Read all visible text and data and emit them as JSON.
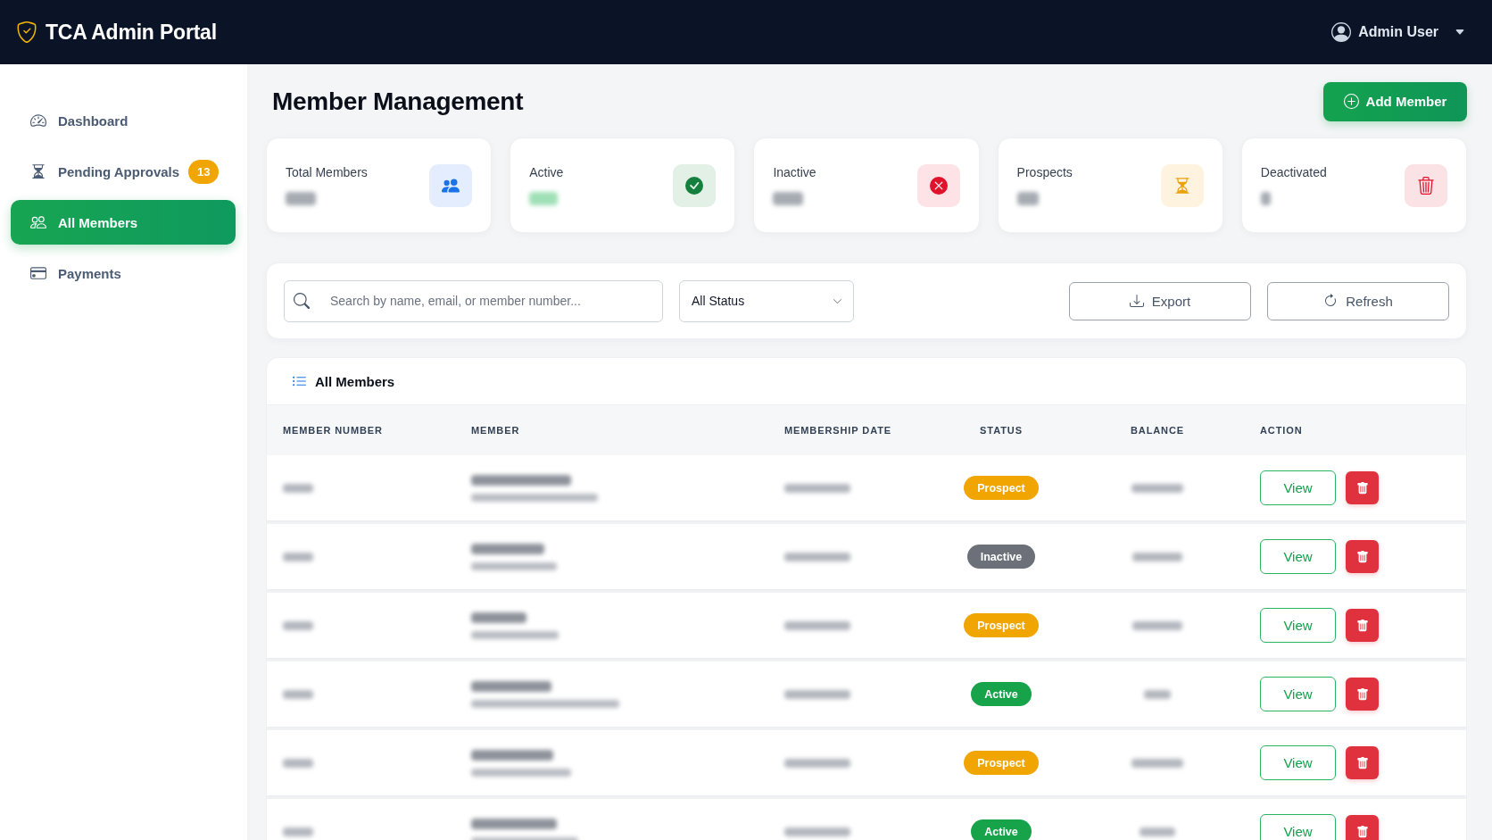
{
  "header": {
    "title": "TCA Admin Portal",
    "user": "Admin User"
  },
  "sidebar": {
    "items": [
      {
        "label": "Dashboard",
        "selected": false
      },
      {
        "label": "Pending Approvals",
        "selected": false,
        "badge": "13"
      },
      {
        "label": "All Members",
        "selected": true
      },
      {
        "label": "Payments",
        "selected": false
      }
    ]
  },
  "page": {
    "title": "Member Management",
    "add_button": "Add Member"
  },
  "stats": [
    {
      "label": "Total Members"
    },
    {
      "label": "Active"
    },
    {
      "label": "Inactive"
    },
    {
      "label": "Prospects"
    },
    {
      "label": "Deactivated"
    }
  ],
  "filters": {
    "search": {
      "placeholder": "Search by name, email, or member number..."
    },
    "status_select": {
      "value": "All Status"
    },
    "buttons": [
      "Export",
      "Refresh"
    ]
  },
  "table": {
    "title": "All Members",
    "columns": [
      "MEMBER NUMBER",
      "MEMBER",
      "MEMBERSHIP DATE",
      "STATUS",
      "BALANCE",
      "ACTION"
    ],
    "rows": [
      {
        "status": {
          "label": "Prospect",
          "color": "#f0a500"
        },
        "action": "View"
      },
      {
        "status": {
          "label": "Inactive",
          "color": "#6b7079"
        },
        "action": "View"
      },
      {
        "status": {
          "label": "Prospect",
          "color": "#f0a500"
        },
        "action": "View"
      },
      {
        "status": {
          "label": "Active",
          "color": "#16a34a"
        },
        "action": "View"
      },
      {
        "status": {
          "label": "Prospect",
          "color": "#f0a500"
        },
        "action": "View"
      },
      {
        "status": {
          "label": "Active",
          "color": "#16a34a"
        },
        "action": "View"
      }
    ]
  }
}
